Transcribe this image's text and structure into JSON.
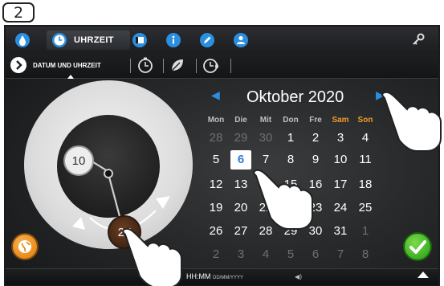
{
  "step": {
    "number": "2"
  },
  "topbar": {
    "tabs": [
      {
        "icon": "water-drop-icon"
      },
      {
        "icon": "clock-icon",
        "label": "UHRZEIT",
        "active": true
      },
      {
        "icon": "folder-icon"
      },
      {
        "icon": "info-icon"
      },
      {
        "icon": "pencil-icon"
      },
      {
        "icon": "user-icon"
      }
    ],
    "key_icon": "key-icon"
  },
  "subbar": {
    "label": "DATUM UND UHRZEIT",
    "icons": [
      "timer-icon",
      "leaf-icon",
      "timer-drop-icon"
    ]
  },
  "dial": {
    "hour": "10",
    "minute": "27"
  },
  "calendar": {
    "month": "Oktober 2020",
    "weekdays": [
      "Mon",
      "Die",
      "Mit",
      "Don",
      "Fre",
      "Sam",
      "Son"
    ],
    "weeks": [
      [
        "28",
        "29",
        "30",
        "1",
        "2",
        "3",
        "4"
      ],
      [
        "5",
        "6",
        "7",
        "8",
        "9",
        "10",
        "11"
      ],
      [
        "12",
        "13",
        "14",
        "15",
        "16",
        "17",
        "18"
      ],
      [
        "19",
        "20",
        "21",
        "22",
        "23",
        "24",
        "25"
      ],
      [
        "26",
        "27",
        "28",
        "29",
        "30",
        "31",
        "1"
      ],
      [
        "2",
        "3",
        "4",
        "5",
        "6",
        "7",
        "8"
      ]
    ],
    "selected_day": "6",
    "colors": {
      "accent": "#2c8ee0",
      "weekend": "#f39a2b"
    }
  },
  "bottombar": {
    "format_main": "HH:MM",
    "format_date": "DD/MM/YYYY"
  },
  "buttons": {
    "globe_icon": "globe-icon",
    "ok_icon": "checkmark-icon"
  }
}
